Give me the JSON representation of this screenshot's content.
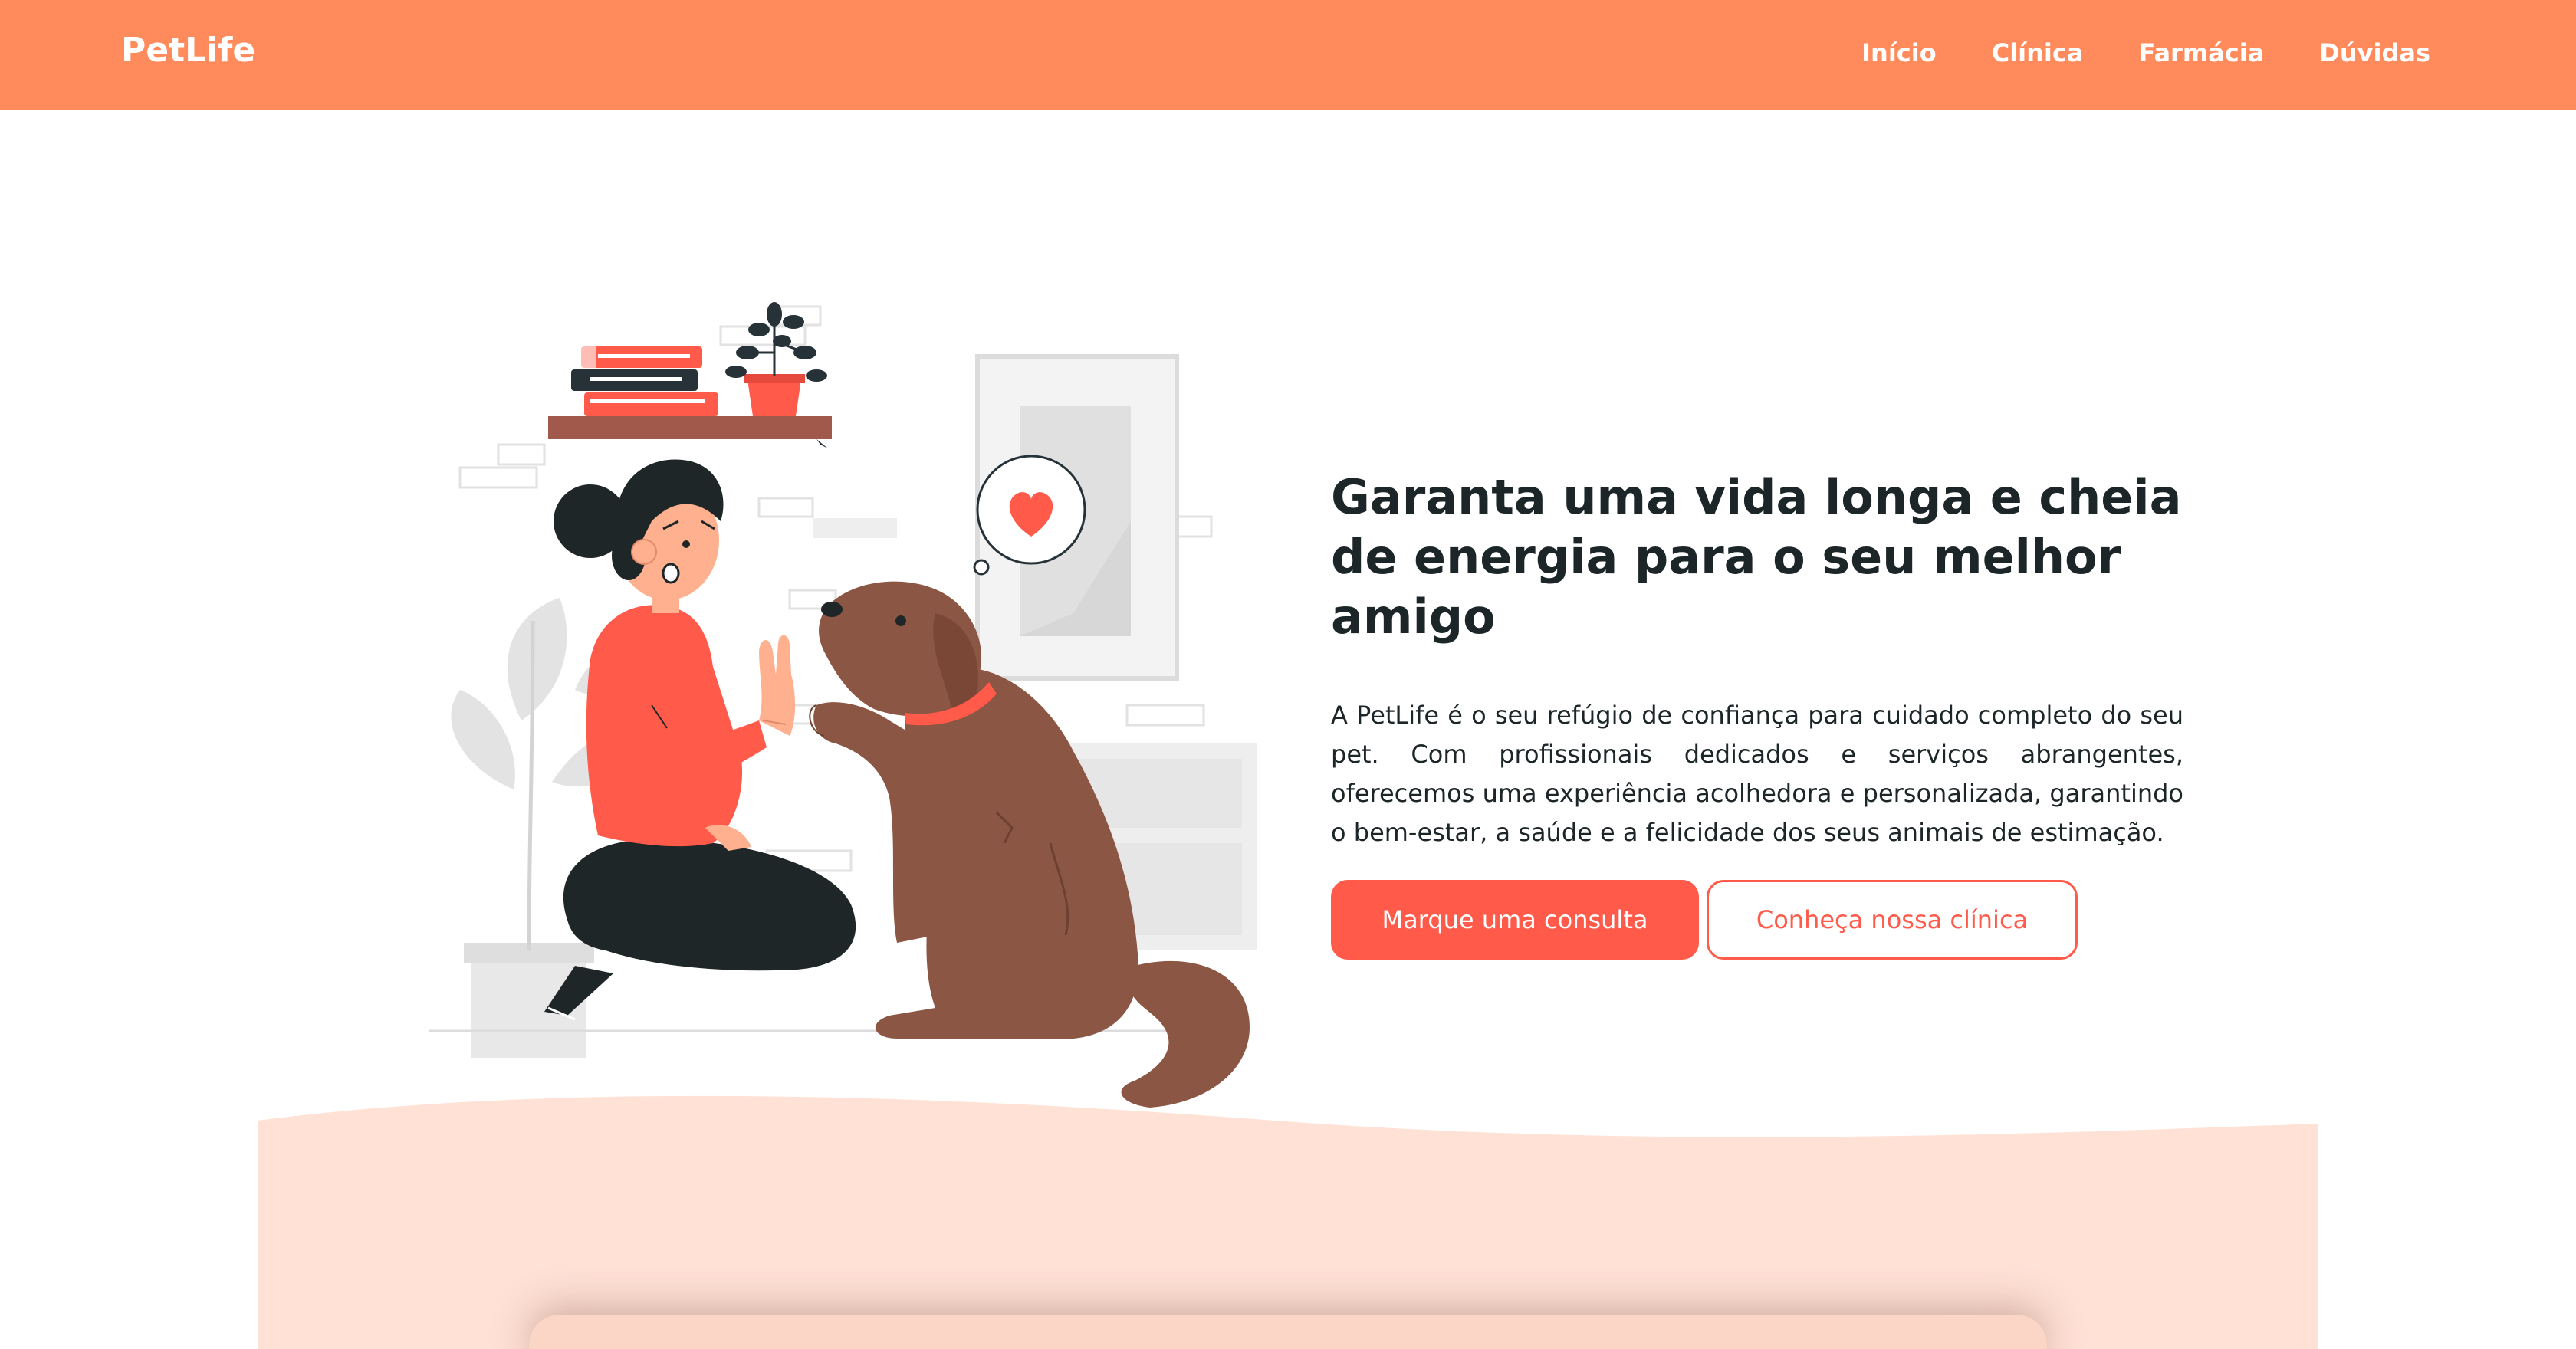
{
  "header": {
    "logo": "PetLife",
    "nav": [
      "Início",
      "Clínica",
      "Farmácia",
      "Dúvidas"
    ]
  },
  "hero": {
    "title": "Garanta uma vida longa e cheia de energia para o seu melhor amigo",
    "description": "A PetLife é o seu refúgio de confiança para cuidado completo do seu pet. Com profissionais dedicados e serviços abrangentes, oferecemos uma experiência acolhedora e personalizada, garantindo o bem-estar, a saúde e a felicidade dos seus animais de estimação.",
    "primary_button": "Marque uma consulta",
    "secondary_button": "Conheça nossa clínica"
  },
  "colors": {
    "header_bg": "#ff8a5c",
    "accent": "#ff5a4a",
    "text_dark": "#1c2527",
    "wave_bg": "#ffe1d6",
    "dog_brown": "#8b5644"
  },
  "illustration": {
    "icon": "woman-high-five-dog-illustration",
    "thought_bubble_icon": "heart-icon"
  }
}
